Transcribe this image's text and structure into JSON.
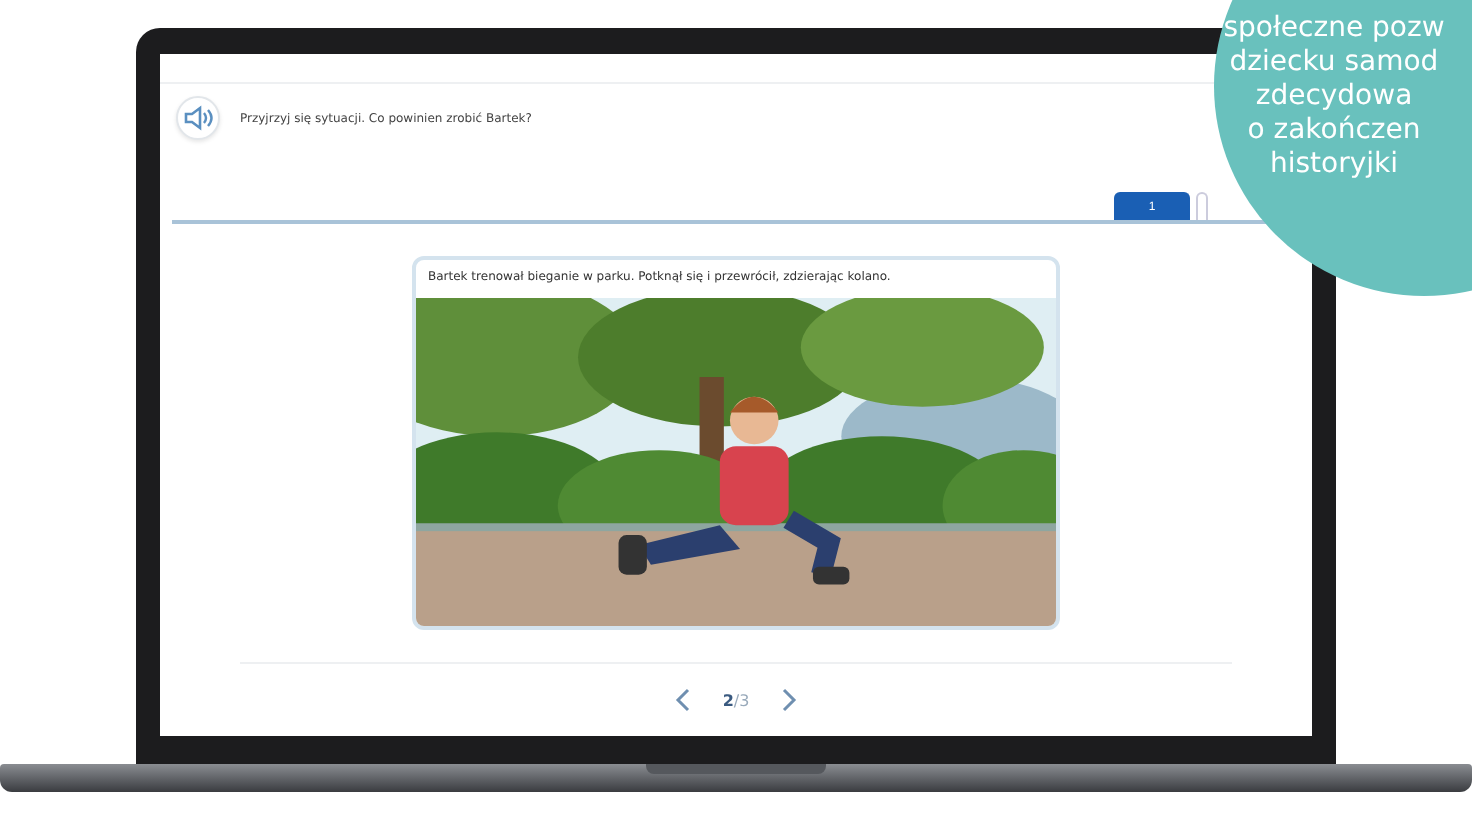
{
  "question": {
    "text": "Przyjrzyj się sytuacji. Co powinien zrobić Bartek?"
  },
  "tabs": [
    {
      "label": "1",
      "selected": true
    },
    {
      "selected": false
    }
  ],
  "card": {
    "caption": "Bartek trenował bieganie w parku. Potknął się i przewrócił, zdzierając kolano."
  },
  "pager": {
    "position": "**2**/3"
  },
  "promo": {
    "lines": [
      "społeczne pozw",
      "dziecku samod",
      "zdecydowa",
      "o zakończen",
      "historyjki"
    ]
  }
}
